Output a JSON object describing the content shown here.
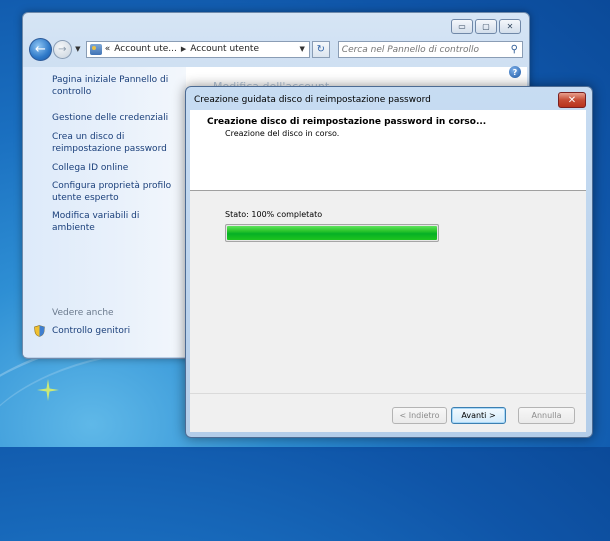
{
  "desktop": {
    "background": "#1a6fc0"
  },
  "control_panel": {
    "caption_buttons": {
      "minimize": "▭",
      "maximize": "▢",
      "close": "✕"
    },
    "breadcrumb": {
      "overflow": "«",
      "items": [
        "Account ute...",
        "Account utente"
      ]
    },
    "search_placeholder": "Cerca nel Pannello di controllo",
    "main_title_partial": "Modifica dell'account",
    "sidebar": {
      "links": [
        "Pagina iniziale Pannello di controllo",
        "Gestione delle credenziali",
        "Crea un disco di reimpostazione password",
        "Collega ID online",
        "Configura proprietà profilo utente esperto",
        "Modifica variabili di ambiente"
      ],
      "see_also": "Vedere anche",
      "parental_controls": "Controllo genitori"
    }
  },
  "dialog": {
    "title": "Creazione guidata disco di reimpostazione password",
    "heading": "Creazione disco di reimpostazione password in corso...",
    "subheading": "Creazione del disco in corso.",
    "status_text": "Stato: 100% completato",
    "progress": 1.0,
    "accent_color": "#06b025",
    "buttons": {
      "back": "< Indietro",
      "next": "Avanti >",
      "cancel": "Annulla"
    }
  }
}
